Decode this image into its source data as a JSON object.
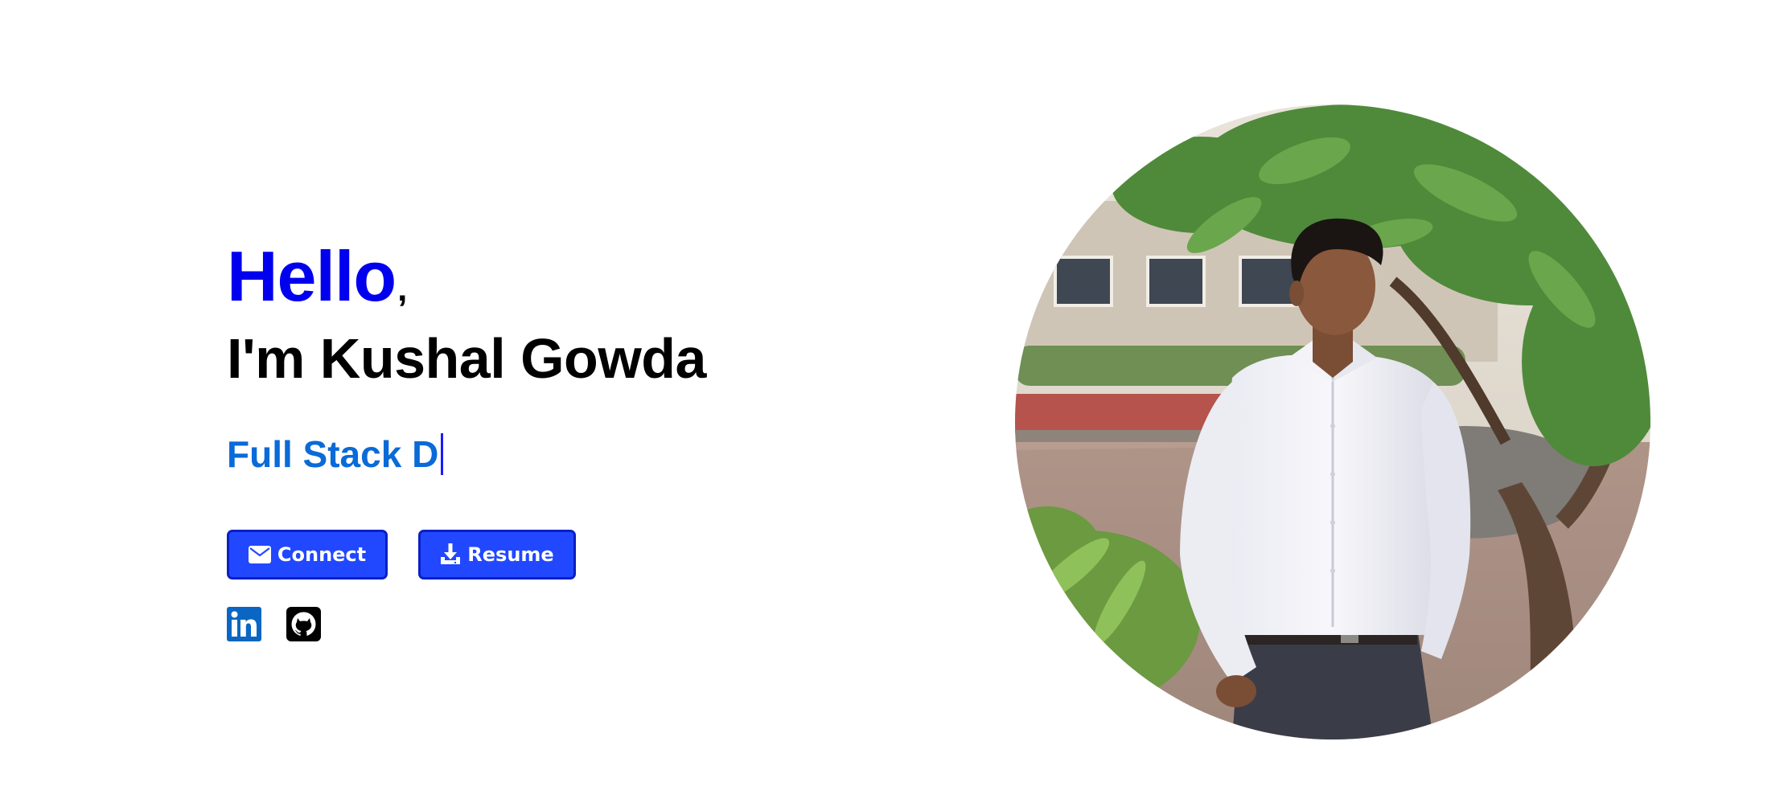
{
  "hero": {
    "greeting": "Hello",
    "greeting_punct": ",",
    "name_line": "I'm Kushal Gowda",
    "typed_role": "Full Stack D",
    "colors": {
      "greeting": "#0000ee",
      "role": "#0a6ad8",
      "button_bg": "#2148ff",
      "button_border": "#0b1fc4"
    }
  },
  "actions": {
    "connect": {
      "label": "Connect",
      "icon": "envelope-icon"
    },
    "resume": {
      "label": "Resume",
      "icon": "download-icon"
    }
  },
  "social": [
    {
      "name": "LinkedIn",
      "icon": "linkedin-icon",
      "color": "#0a66c2"
    },
    {
      "name": "GitHub",
      "icon": "github-icon",
      "color": "#000000"
    }
  ],
  "portrait": {
    "subject": "person-photo"
  }
}
